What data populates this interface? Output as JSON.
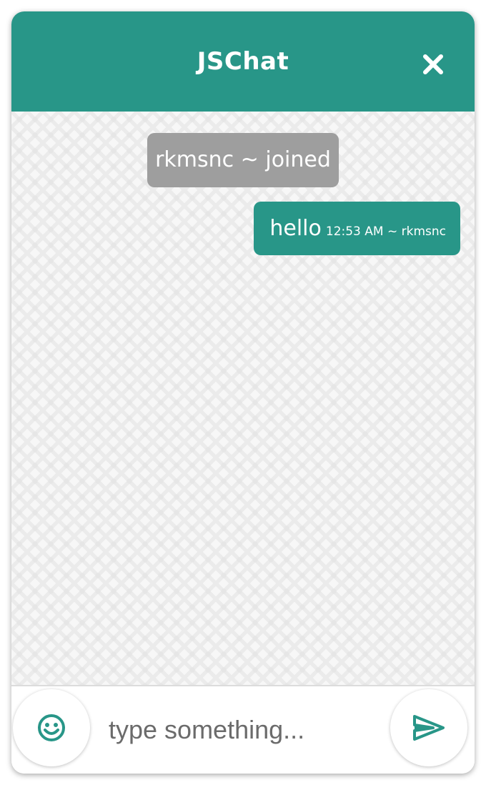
{
  "app": {
    "title": "JSChat"
  },
  "header": {
    "close_icon": "close-icon"
  },
  "messages": {
    "system": "rkmsnc ~ joined",
    "items": [
      {
        "text": "hello",
        "meta": "12:53 AM ~ rkmsnc"
      }
    ]
  },
  "composer": {
    "placeholder": "type something...",
    "value": "",
    "emoji_icon": "smiley-icon",
    "send_icon": "send-icon"
  },
  "colors": {
    "accent": "#289688",
    "system_bubble": "#9e9e9e"
  }
}
